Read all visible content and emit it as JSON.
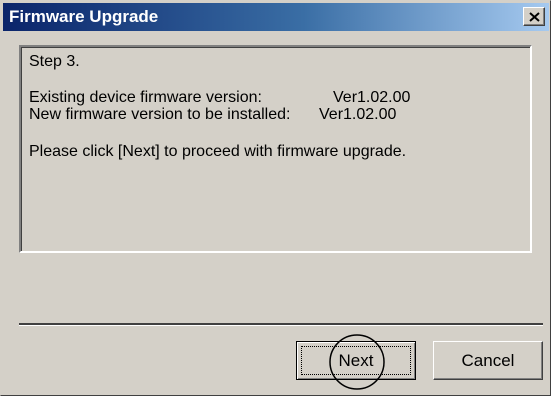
{
  "window": {
    "title": "Firmware Upgrade"
  },
  "step": {
    "label": "Step 3."
  },
  "versions": {
    "existing_label": "Existing device firmware version:",
    "existing_value": "Ver1.02.00",
    "new_label": "New firmware version to be installed:",
    "new_value": "Ver1.02.00"
  },
  "instruction": "Please click [Next] to proceed with firmware upgrade.",
  "buttons": {
    "next_label": "Next",
    "cancel_label": "Cancel"
  },
  "icons": {
    "close": "close-icon"
  },
  "colors": {
    "titlebar_start": "#0a246a",
    "titlebar_end": "#a6caf0",
    "dialog_face": "#d4d0c8",
    "annotation_circle": "#000000"
  }
}
